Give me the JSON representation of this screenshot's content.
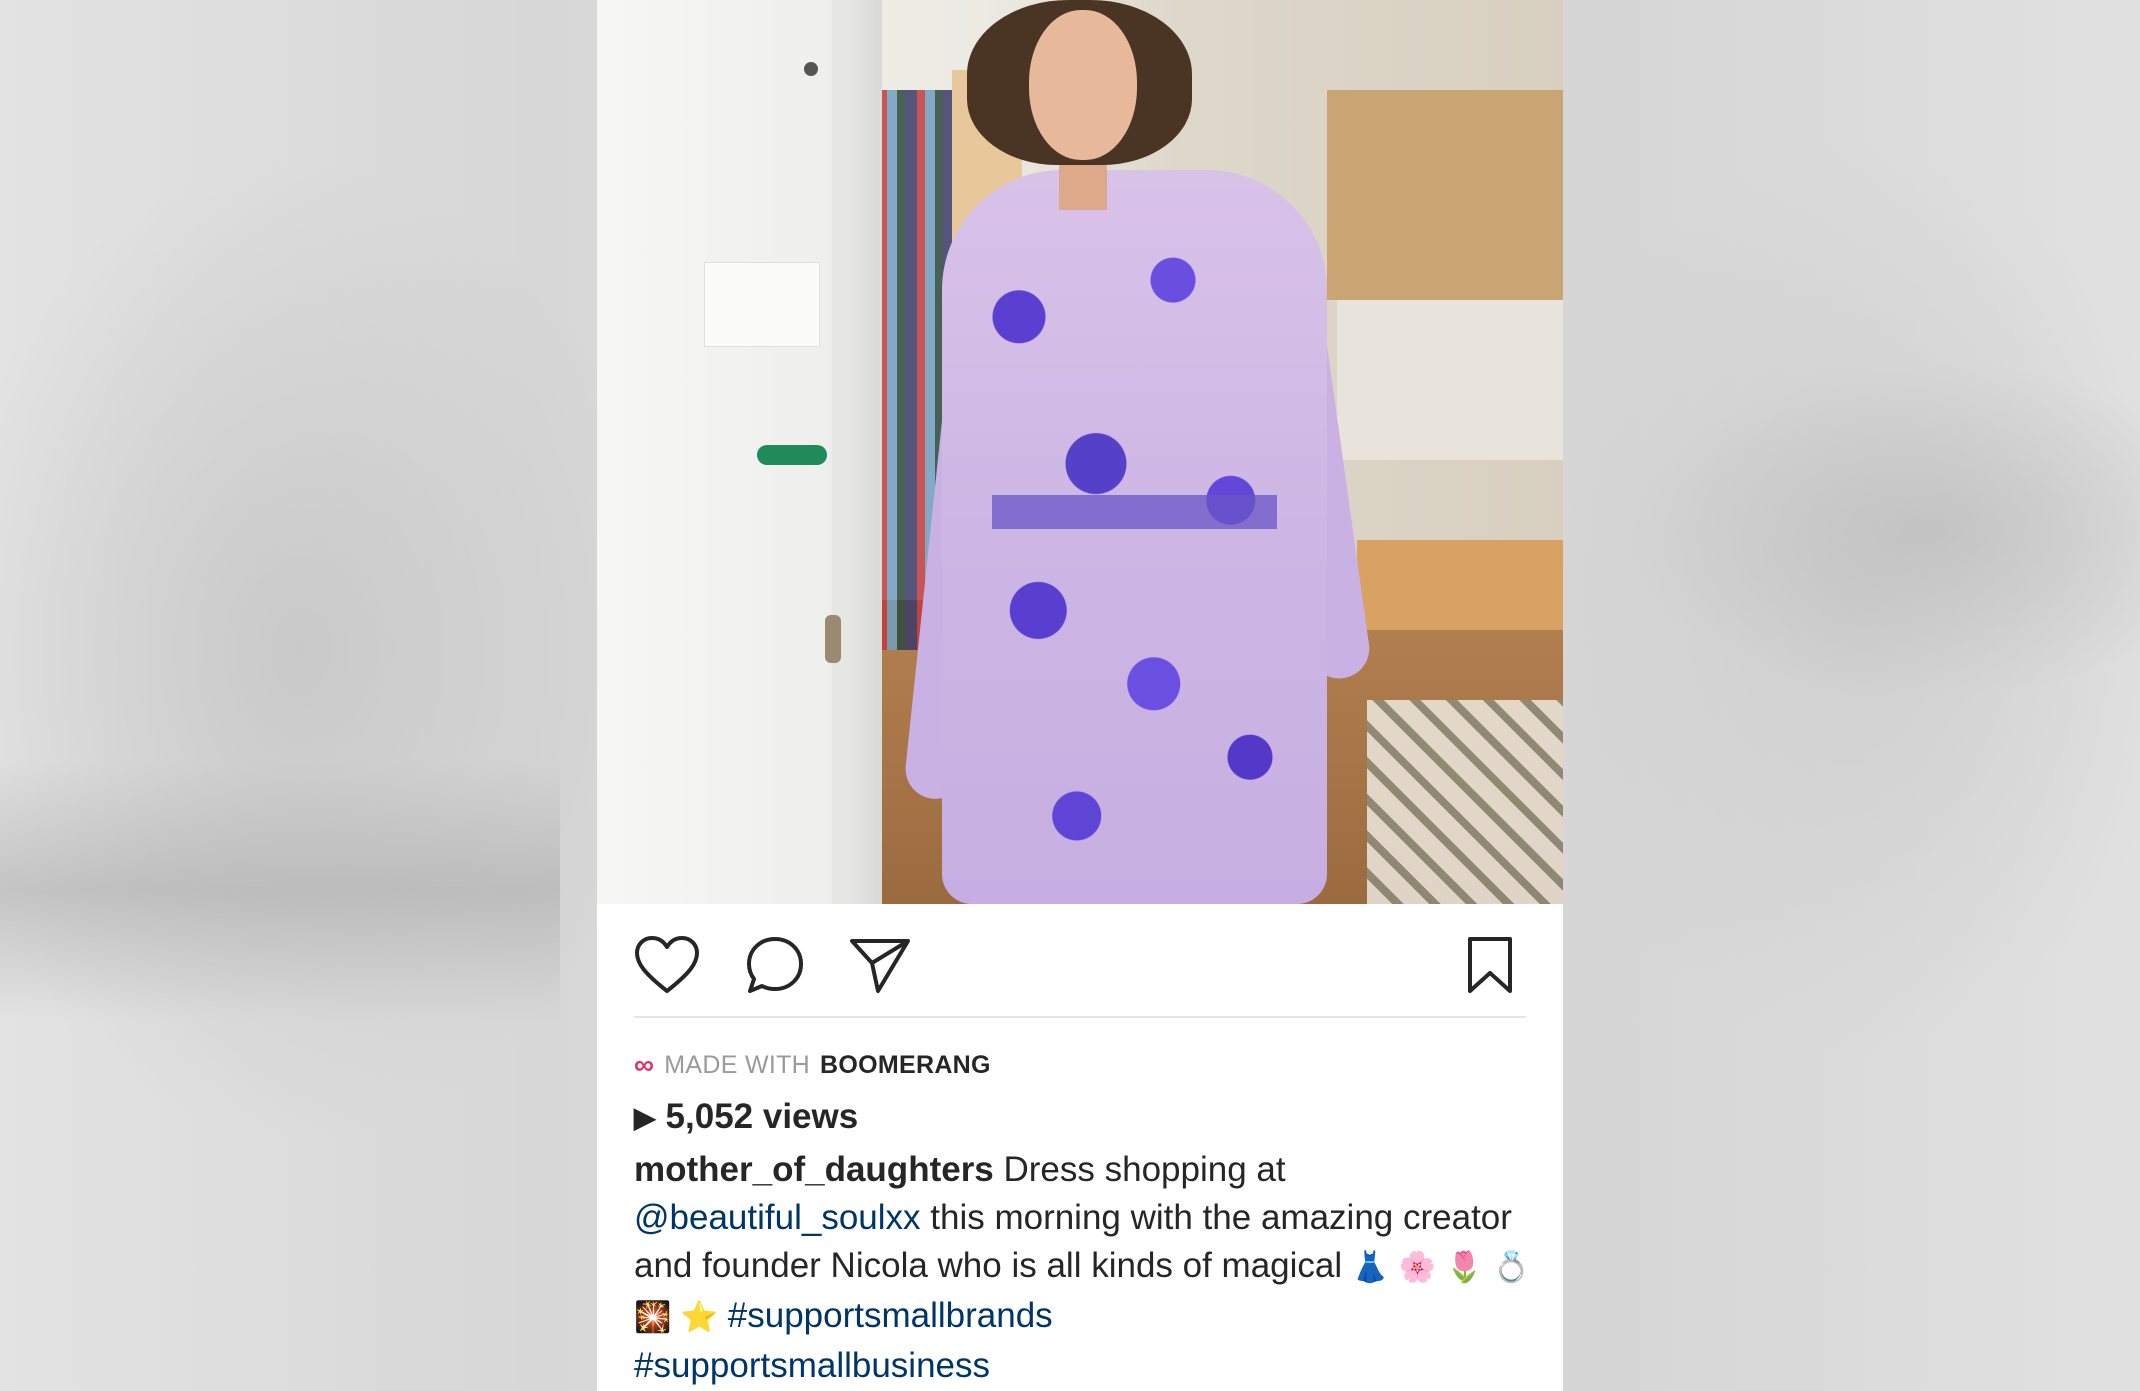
{
  "post": {
    "boomerang": {
      "logo": "∞",
      "made_with": "MADE WITH",
      "brand": "BOOMERANG"
    },
    "views": {
      "play_symbol": "▶",
      "count": "5,052 views"
    },
    "caption": {
      "username": "mother_of_daughters",
      "text_1": " Dress shopping at ",
      "mention": "@beautiful_soulxx",
      "text_2": " this morning with the amazing creator and founder Nicola who is all kinds of magical ",
      "emojis": "👗 🌸 🌷 💍 🎇 ⭐ ",
      "hashtag_1": "#supportsmallbrands",
      "hashtag_2": "#supportsmallbusiness"
    },
    "icons": {
      "like": "heart-icon",
      "comment": "comment-icon",
      "share": "send-icon",
      "save": "bookmark-icon"
    },
    "colors": {
      "boomerang_accent": "#e1306c",
      "link": "#003569",
      "text": "#262626",
      "muted": "#9a9a9a"
    }
  }
}
